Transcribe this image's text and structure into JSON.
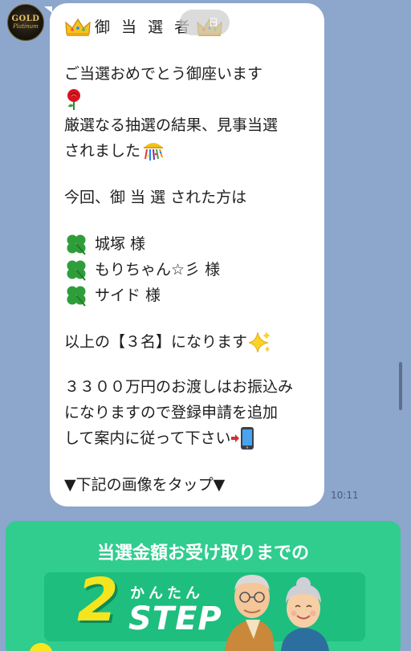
{
  "sender": {
    "avatar_logo_text": "GOLD",
    "avatar_logo_subtext": "Platinum"
  },
  "date_pill": {
    "label": "日"
  },
  "message": {
    "title": "御 当 選 者",
    "lines": [
      "ご当選おめでとう御座います",
      "厳選なる抽選の結果、見事当選",
      "されました",
      "今回、御 当 選 された方は",
      "城塚 様",
      "もりちゃん☆彡 様",
      "サイド 様",
      "以上の【３名】になります",
      "３３００万円のお渡しはお振込み",
      "になりますので登録申請を追加",
      "して案内に従って下さい",
      "▼下記の画像をタップ▼"
    ],
    "time": "10:11"
  },
  "banner": {
    "title": "当選金額お受け取りまでの",
    "step_number": "2",
    "step_kana": "かんたん",
    "step_word": "STEP"
  },
  "icons": {
    "crown": "crown-icon",
    "rose": "rose-icon",
    "confetti": "confetti-ball-icon",
    "clover": "four-leaf-clover-icon",
    "sparkles": "sparkles-icon",
    "arrow": "arrow-right-icon",
    "phone": "mobile-phone-icon"
  },
  "colors": {
    "chat_background": "#8ca6cc",
    "bubble": "#ffffff",
    "banner_green": "#30cd8e",
    "banner_yellow": "#f5e51e"
  }
}
